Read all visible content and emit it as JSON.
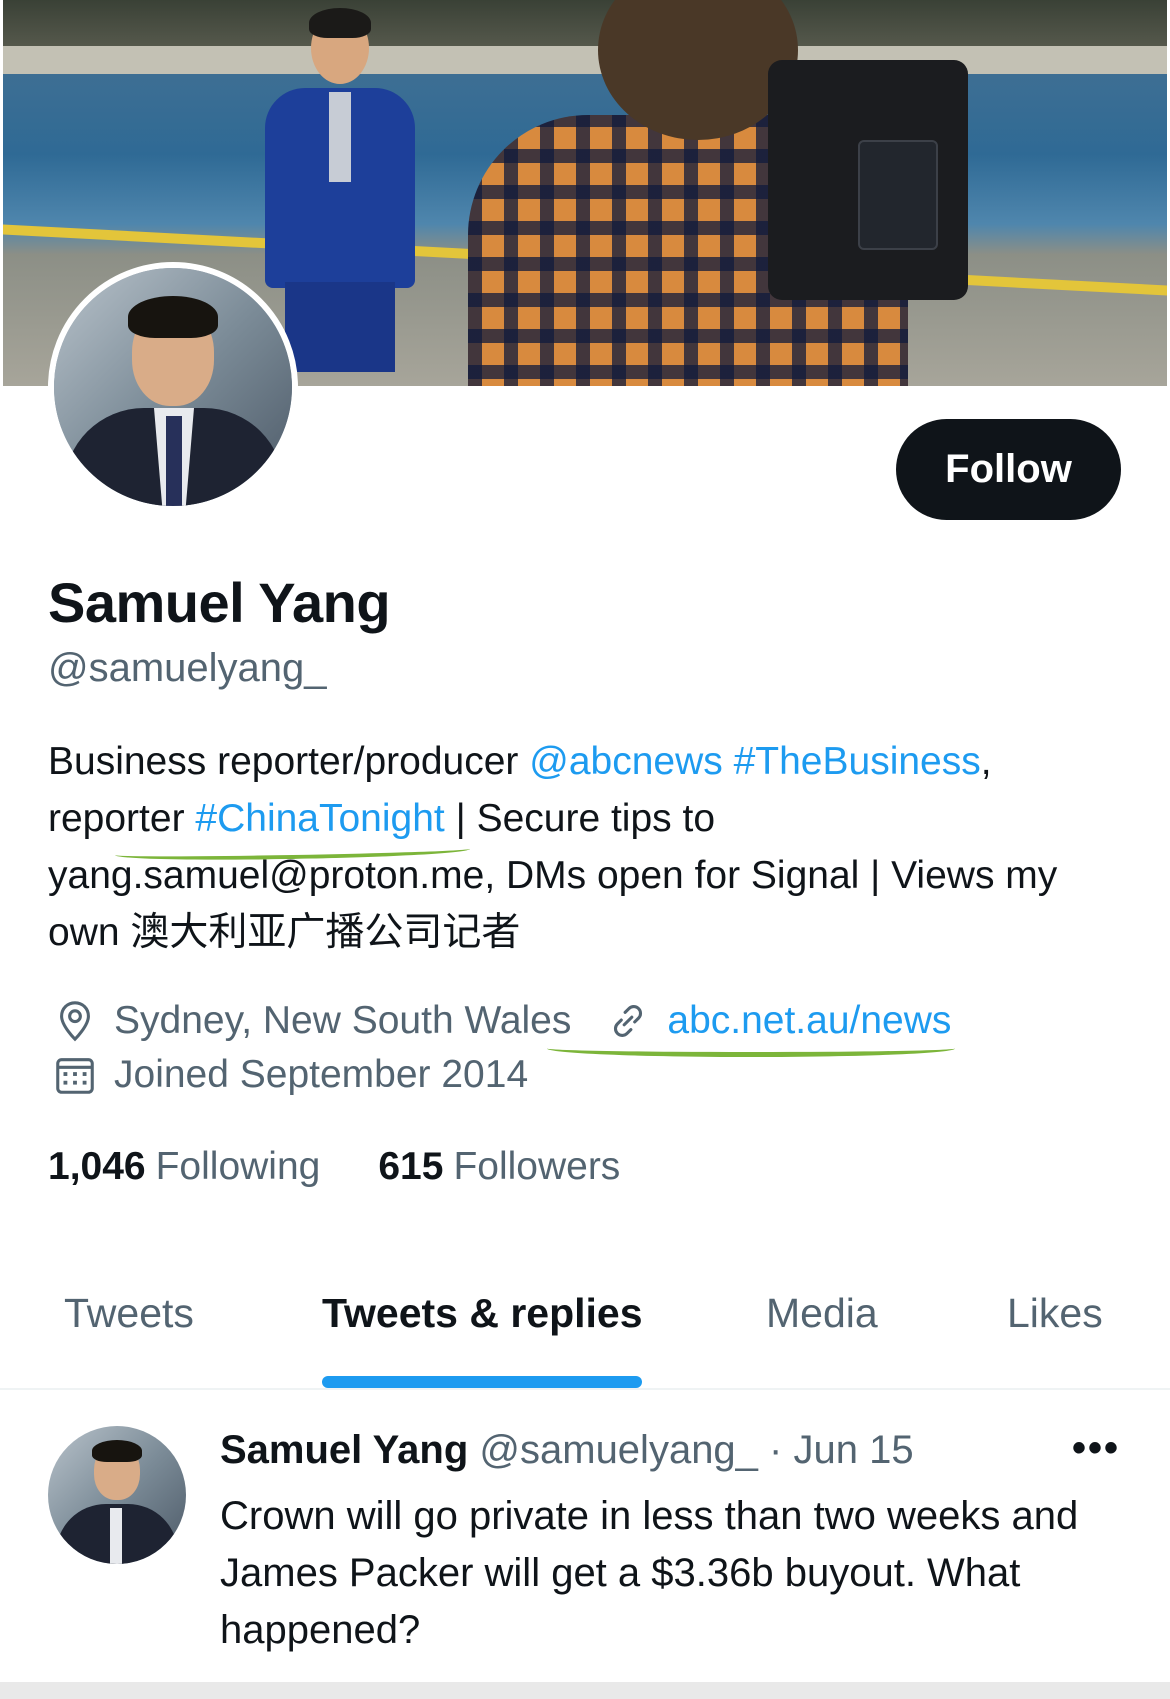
{
  "profile": {
    "name": "Samuel Yang",
    "handle": "@samuelyang_",
    "follow_label": "Follow",
    "bio": {
      "t1": "Business reporter/producer ",
      "mention": "@abcnews",
      "t2": " ",
      "hashtag1": "#TheBusiness",
      "t3": ",",
      "t4": "reporter ",
      "hashtag2": "#ChinaTonight",
      "t5": " | Secure tips to",
      "t6": "yang.samuel@proton.me, DMs open for Signal | Views my",
      "t7": "own 澳大利亚广播公司记者"
    },
    "location": "Sydney, New South Wales",
    "website": "abc.net.au/news",
    "joined": "Joined September 2014",
    "following_count": "1,046",
    "following_label": "Following",
    "followers_count": "615",
    "followers_label": "Followers"
  },
  "tabs": [
    "Tweets",
    "Tweets & replies",
    "Media",
    "Likes"
  ],
  "active_tab": "Tweets & replies",
  "tweet": {
    "name": "Samuel Yang",
    "handle": "@samuelyang_",
    "separator": " · ",
    "date": "Jun 15",
    "more": "•••",
    "text": "Crown will go private in less than two weeks and James Packer will get a $3.36b buyout. What happened?"
  },
  "icons": {
    "location": "map-pin-icon",
    "website": "link-icon",
    "joined": "calendar-icon",
    "more": "more-horizontal-icon"
  },
  "colors": {
    "accent": "#1d9bf0",
    "text": "#0f1419",
    "secondary": "#536471",
    "annotation": "#7cb53a"
  }
}
